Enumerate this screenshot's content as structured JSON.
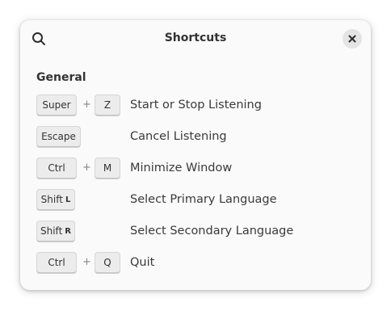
{
  "window": {
    "title": "Shortcuts"
  },
  "icons": {
    "search": "search-icon",
    "close": "close-icon"
  },
  "section": {
    "title": "General"
  },
  "shortcuts": [
    {
      "keys": [
        "Super",
        "Z"
      ],
      "action": "Start or Stop Listening"
    },
    {
      "keys": [
        "Escape"
      ],
      "action": "Cancel Listening"
    },
    {
      "keys": [
        "Ctrl",
        "M"
      ],
      "action": "Minimize Window"
    },
    {
      "keys": [
        {
          "mod": "Shift",
          "key": "L"
        }
      ],
      "action": "Select Primary Language"
    },
    {
      "keys": [
        {
          "mod": "Shift",
          "key": "R"
        }
      ],
      "action": "Select Secondary Language"
    },
    {
      "keys": [
        "Ctrl",
        "Q"
      ],
      "action": "Quit"
    }
  ],
  "plus_sign": "+"
}
